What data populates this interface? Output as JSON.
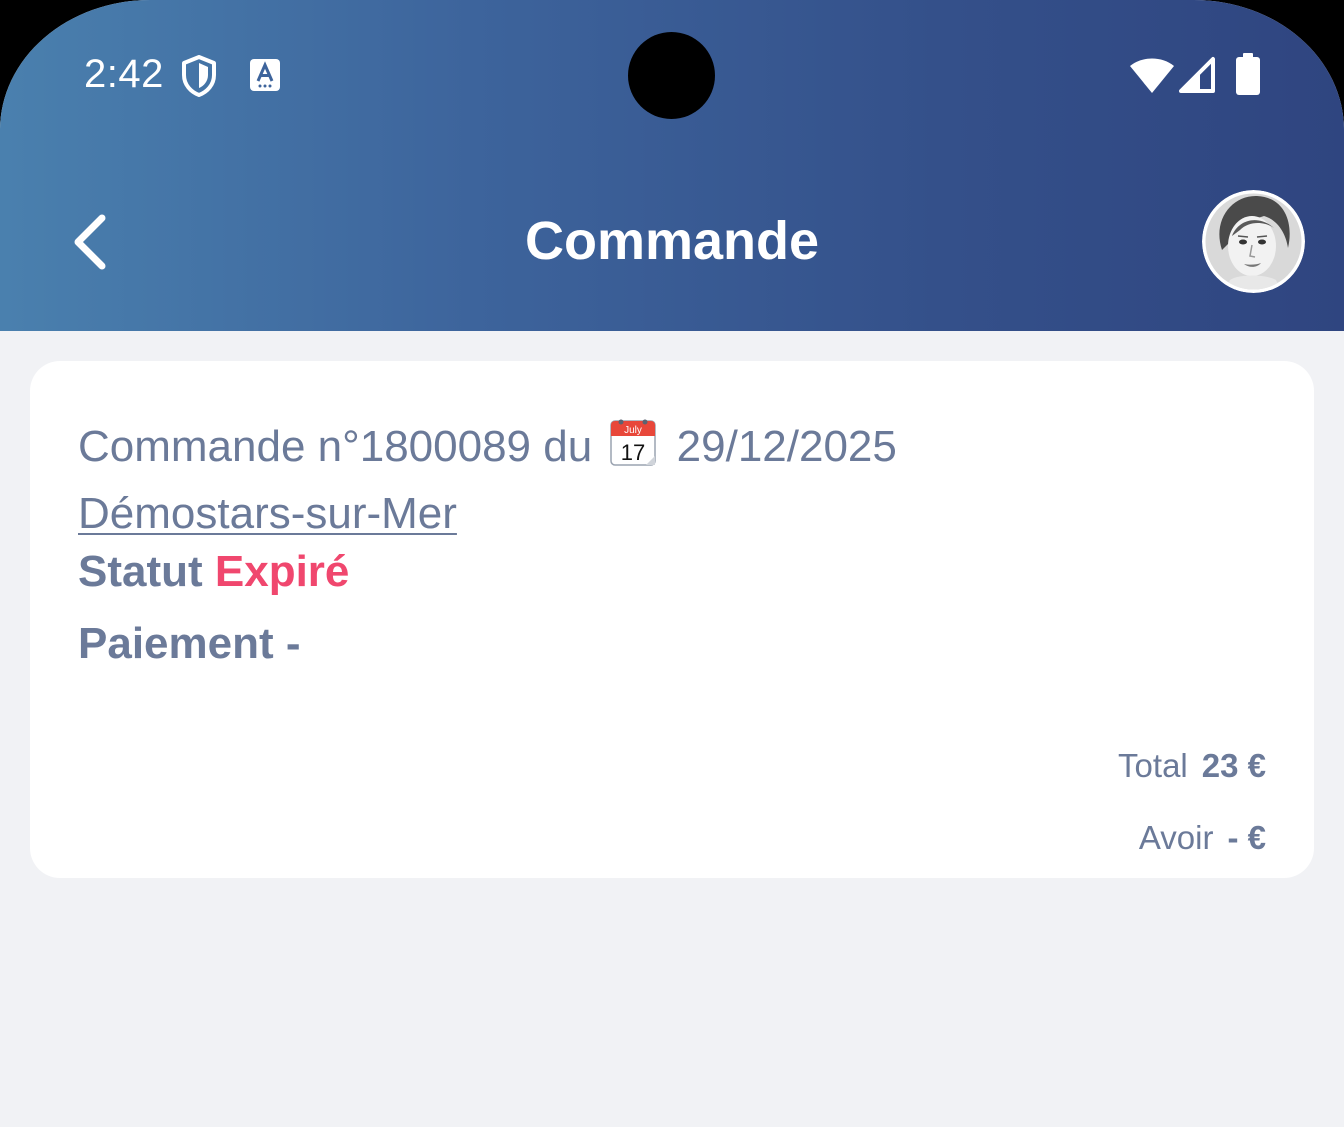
{
  "status_bar": {
    "time": "2:42"
  },
  "header": {
    "title": "Commande"
  },
  "order": {
    "prefix": "Commande n°1800089 du",
    "calendar_icon_month": "July",
    "calendar_icon_day": "17",
    "date": "29/12/2025",
    "city": "Démostars-sur-Mer",
    "status_label": "Statut",
    "status_value": "Expiré",
    "payment_label": "Paiement",
    "payment_value": "-",
    "total_label": "Total",
    "total_value": "23 €",
    "avoir_label": "Avoir",
    "avoir_value": "- €"
  },
  "colors": {
    "header_start": "#4a80ae",
    "header_end": "#2f4580",
    "text_muted": "#6b7a99",
    "status_expired": "#f0476e",
    "background": "#f1f2f5"
  },
  "icons": {
    "status_bar_left": [
      "shield-icon",
      "font-a-icon"
    ],
    "status_bar_right": [
      "wifi-icon",
      "signal-icon",
      "battery-icon"
    ],
    "header_left": "chevron-left-icon",
    "inline": "calendar-icon"
  }
}
